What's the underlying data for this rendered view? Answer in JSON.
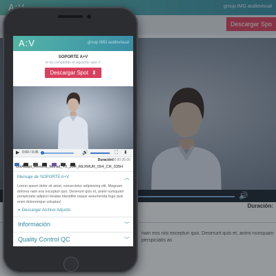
{
  "brand": {
    "logo": "A:V",
    "group_prefix": "group",
    "group_name": "IMG audiovisual"
  },
  "background": {
    "download_label": "Descargar Spo",
    "duracion_label": "Duración:",
    "body_text": "nam eos nisi excepturi quo. Deserunt quis et, animi numquam perspiciatis as"
  },
  "share": {
    "sender": "SOPORTE A+V",
    "shared_text": "te ha compartido el siguiente spot",
    "download_label": "Descargar Spot"
  },
  "player": {
    "time": "0:00 / 0:35",
    "duration_label": "Duración:",
    "duration_value": "00:00:35:00"
  },
  "file": {
    "name": "UniAdapt_Rexona_Murad_Y2_35H_REXMUR_054_CR_035H"
  },
  "message": {
    "title_prefix": "Mensaje de",
    "title_sender": "SOPORTE A+V",
    "body": "Lorem ipsum dolor sit amet, consectetur adipisicing elit. Magnam dolores nam eos excepturi quo. Deserunt quis et, animi numquam perspiciatis adipisci beatae blanditiis eaque assumenda fuga quis enim doloremque voluptas!",
    "attachment_label": "Descargar Archivo Adjunto"
  },
  "sections": [
    {
      "label": "Información"
    },
    {
      "label": "Quality Control QC"
    }
  ],
  "colors": {
    "accent": "#3b8fa8",
    "header_gradient_start": "#53b4a7",
    "header_gradient_end": "#3a8ea6",
    "download_button": "#d9405e"
  },
  "icons": [
    "download-icon",
    "play-icon",
    "volume-icon",
    "fullscreen-icon",
    "chevron-up-icon",
    "chevron-down-icon",
    "link-icon"
  ]
}
